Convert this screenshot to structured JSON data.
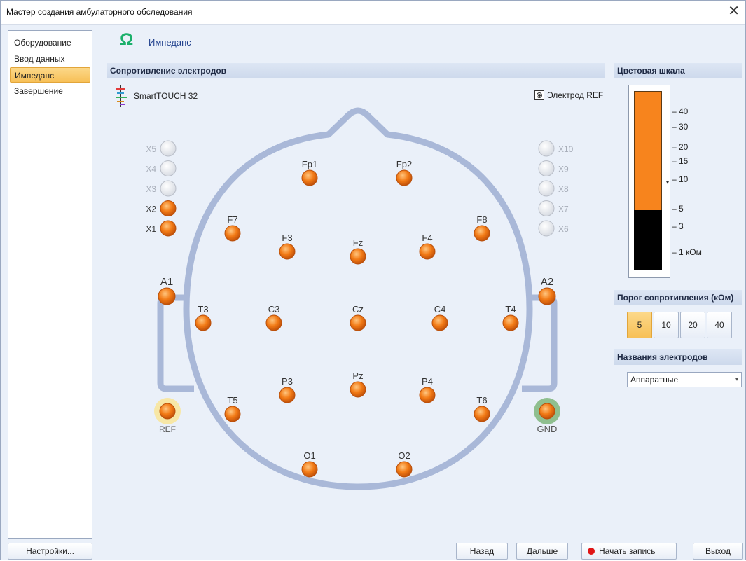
{
  "window": {
    "title": "Мастер создания амбулаторного обследования",
    "close_icon": "close-icon"
  },
  "nav": {
    "items": [
      {
        "label": "Оборудование",
        "active": false
      },
      {
        "label": "Ввод данных",
        "active": false
      },
      {
        "label": "Импеданс",
        "active": true
      },
      {
        "label": "Завершение",
        "active": false
      }
    ]
  },
  "step": {
    "icon": "omega-icon",
    "icon_glyph": "Ω",
    "title": "Импеданс"
  },
  "electrodes_panel": {
    "header": "Сопротивление электродов",
    "device_icon": "electrode-cap-icon",
    "device_name": "SmartTOUCH 32",
    "ref_toggle_label": "Электрод REF",
    "ref_toggle_checked": true
  },
  "electrodes": {
    "extra_left": [
      {
        "label": "X5",
        "active": false
      },
      {
        "label": "X4",
        "active": false
      },
      {
        "label": "X3",
        "active": false
      },
      {
        "label": "X2",
        "active": true
      },
      {
        "label": "X1",
        "active": true
      }
    ],
    "extra_right": [
      {
        "label": "X10",
        "active": false
      },
      {
        "label": "X9",
        "active": false
      },
      {
        "label": "X8",
        "active": false
      },
      {
        "label": "X7",
        "active": false
      },
      {
        "label": "X6",
        "active": false
      }
    ],
    "scalp": [
      "Fp1",
      "Fp2",
      "F7",
      "F3",
      "Fz",
      "F4",
      "F8",
      "A1",
      "T3",
      "C3",
      "Cz",
      "C4",
      "T4",
      "A2",
      "P3",
      "Pz",
      "P4",
      "T5",
      "T6",
      "O1",
      "O2"
    ],
    "ref_label": "REF",
    "gnd_label": "GND"
  },
  "color_scale": {
    "header": "Цветовая шкала",
    "ticks": [
      "– 40",
      "– 30",
      "– 20",
      "– 15",
      "– 10",
      "– 5",
      "– 3",
      "– 1 кОм"
    ],
    "marker_glyph": "▾",
    "colors": {
      "high": "#f7841d",
      "low": "#000000"
    }
  },
  "threshold": {
    "header": "Порог сопротивления (кОм)",
    "options": [
      "5",
      "10",
      "20",
      "40"
    ],
    "selected": "5"
  },
  "electrode_names": {
    "header": "Названия электродов",
    "selected": "Аппаратные",
    "arrow_glyph": "▾"
  },
  "footer": {
    "settings_label": "Настройки...",
    "back_label": "Назад",
    "next_label": "Дальше",
    "record_label": "Начать запись",
    "exit_label": "Выход"
  },
  "colors": {
    "electrode_active": "#f27a15",
    "electrode_inactive": "#e4e6ea",
    "head_outline": "#a9b8d8",
    "ref_glow": "#f7e7a6",
    "gnd_glow": "#8fbf8f",
    "accent_selected": "#f7c057"
  }
}
